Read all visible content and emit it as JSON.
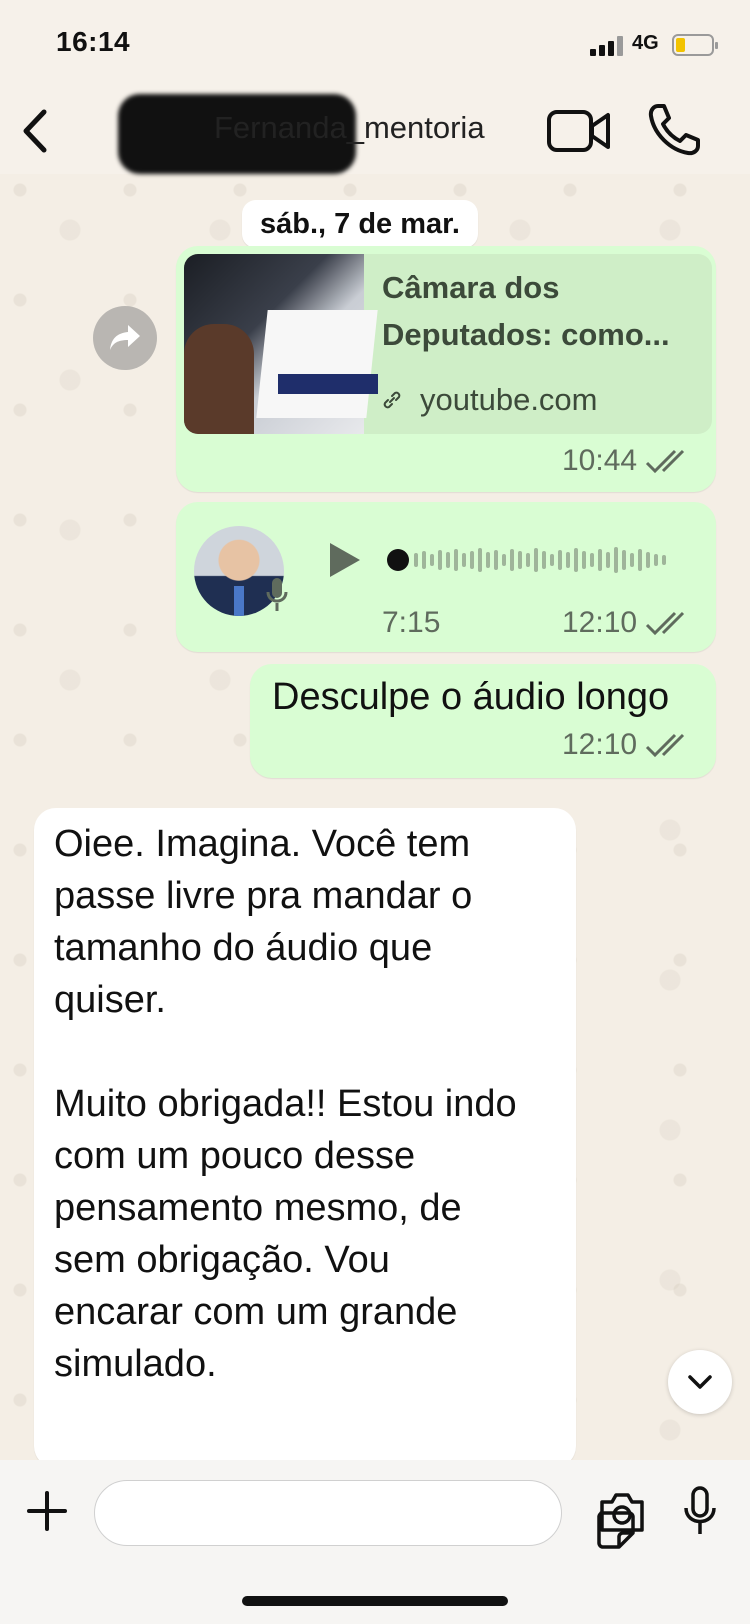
{
  "status_bar": {
    "time": "16:14",
    "network": "4G"
  },
  "header": {
    "contact_name": "Fernanda_mentoria"
  },
  "date_separator": "sáb., 7 de mar.",
  "messages": {
    "link": {
      "title": "Câmara dos Deputados: como...",
      "domain": "youtube.com",
      "time": "10:44"
    },
    "audio": {
      "duration": "7:15",
      "time": "12:10"
    },
    "text_out": {
      "text": "Desculpe o áudio longo",
      "time": "12:10"
    },
    "text_in": {
      "text": "Oiee. Imagina. Você tem\npasse livre pra mandar o\ntamanho do áudio que\nquiser.\n\nMuito obrigada!! Estou indo\ncom um pouco desse\npensamento mesmo, de\nsem obrigação. Vou\nencarar com um grande\nsimulado."
    }
  },
  "colors": {
    "outgoing_bubble": "#d9fdd3",
    "incoming_bubble": "#ffffff",
    "background": "#f4eee5"
  },
  "icons": [
    "back-icon",
    "video-call-icon",
    "phone-icon",
    "forward-icon",
    "link-icon",
    "play-icon",
    "mic-icon",
    "double-check-icon",
    "chevron-down-icon",
    "plus-icon",
    "sticker-icon",
    "camera-icon",
    "microphone-icon"
  ]
}
